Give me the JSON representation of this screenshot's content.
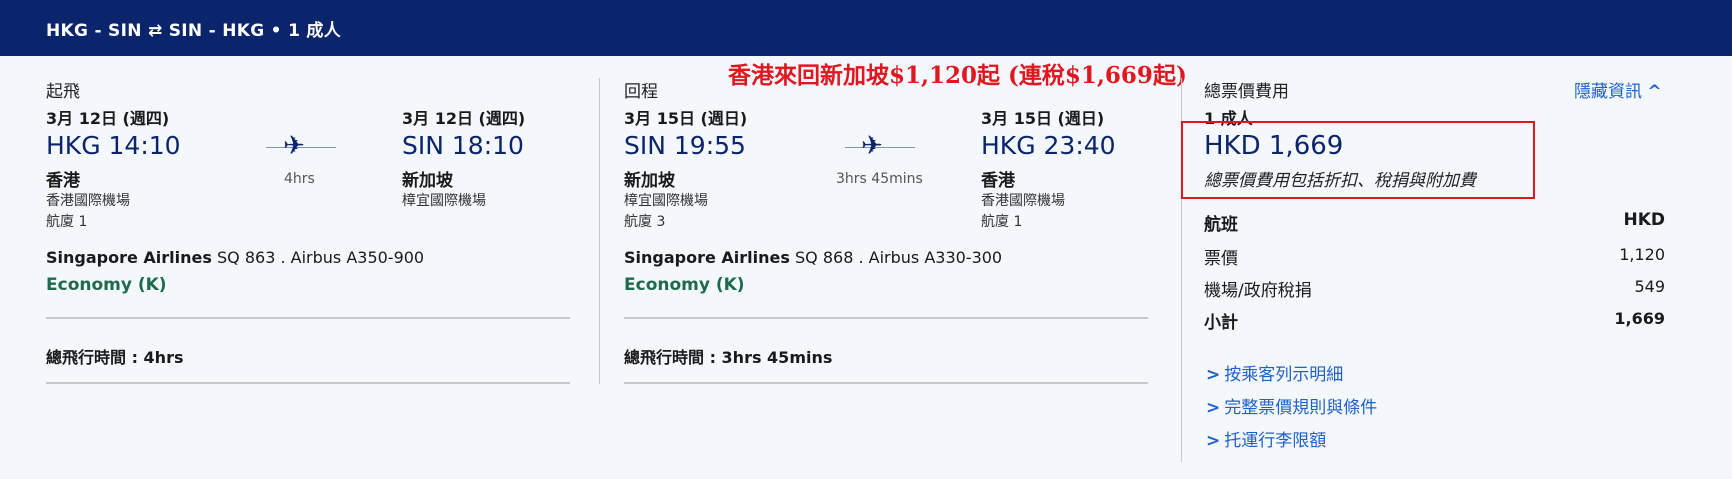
{
  "header": {
    "summary": "HKG - SIN ⇄ SIN - HKG  •  1 成人"
  },
  "promo": {
    "title": "香港來回新加坡$1,120起 (連稅$1,669起)"
  },
  "outbound": {
    "section_label": "起飛",
    "dep_date": "3月 12日 (週四)",
    "dep_route": "HKG 14:10",
    "dep_city": "香港",
    "dep_airport": "香港國際機場",
    "dep_terminal": "航廈 1",
    "duration": "4hrs",
    "arr_date": "3月 12日 (週四)",
    "arr_route": "SIN 18:10",
    "arr_city": "新加坡",
    "arr_airport": "樟宜國際機場",
    "airline": "Singapore Airlines",
    "flight_info": " SQ 863 . Airbus A350-900",
    "cabin": "Economy (K)",
    "total_time": "總飛行時間 : 4hrs"
  },
  "inbound": {
    "section_label": "回程",
    "dep_date": "3月 15日 (週日)",
    "dep_route": "SIN 19:55",
    "dep_city": "新加坡",
    "dep_airport": "樟宜國際機場",
    "dep_terminal": "航廈 3",
    "duration": "3hrs 45mins",
    "arr_date": "3月 15日 (週日)",
    "arr_route": "HKG 23:40",
    "arr_city": "香港",
    "arr_airport": "香港國際機場",
    "arr_terminal": "航廈 1",
    "airline": "Singapore Airlines",
    "flight_info": " SQ 868 . Airbus A330-300",
    "cabin": "Economy (K)",
    "total_time": "總飛行時間 : 3hrs 45mins"
  },
  "pricing": {
    "label": "總票價費用",
    "hide_label": "隱藏資訊",
    "passengers": "1 成人",
    "total": "HKD 1,669",
    "note": "總票價費用包括折扣、稅捐與附加費",
    "table_header_left": "航班",
    "table_header_right": "HKD",
    "rows": [
      {
        "label": "票價",
        "value": "1,120"
      },
      {
        "label": "機場/政府稅捐",
        "value": "549"
      },
      {
        "label": "小計",
        "value": "1,669"
      }
    ],
    "links": [
      "按乘客列示明細",
      "完整票價規則與條件",
      "托運行李限額"
    ]
  },
  "icons": {
    "plane": "airplane-icon",
    "chevron_up": "chevron-up-icon",
    "chevron_right": "chevron-right-icon"
  }
}
